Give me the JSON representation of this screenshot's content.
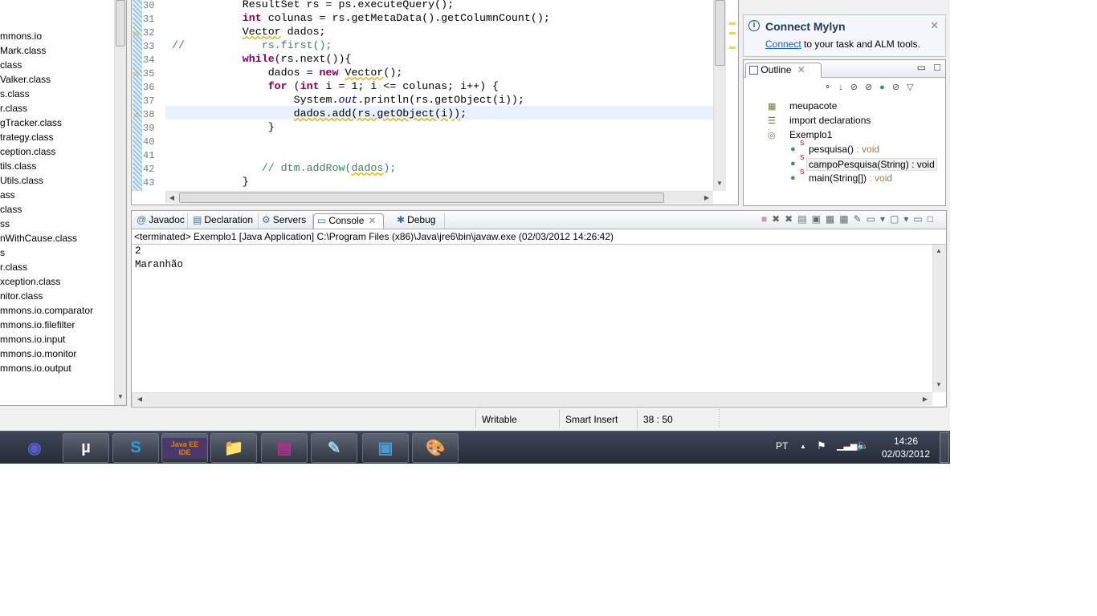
{
  "explorer": {
    "items": [
      "mmons.io",
      "Mark.class",
      "class",
      "Valker.class",
      "s.class",
      "r.class",
      "gTracker.class",
      "trategy.class",
      "ception.class",
      "tils.class",
      "Utils.class",
      "ass",
      "class",
      "ss",
      "nWithCause.class",
      "s",
      "r.class",
      "xception.class",
      "nitor.class",
      "mmons.io.comparator",
      "mmons.io.filefilter",
      "mmons.io.input",
      "mmons.io.monitor",
      "mmons.io.output"
    ]
  },
  "editor": {
    "line_numbers": [
      "30",
      "31",
      "32",
      "33",
      "34",
      "35",
      "36",
      "37",
      "38",
      "39",
      "40",
      "41",
      "42",
      "43"
    ],
    "warning_lines": [
      "32",
      "35",
      "38"
    ],
    "current_line": "38",
    "lines": [
      [
        {
          "t": "           ResultSet rs = ps.executeQuery();",
          "c": ""
        }
      ],
      [
        {
          "t": "           ",
          "c": ""
        },
        {
          "t": "int",
          "c": "kw"
        },
        {
          "t": " colunas = rs.getMetaData().getColumnCount();",
          "c": ""
        }
      ],
      [
        {
          "t": "           ",
          "c": ""
        },
        {
          "t": "Vector",
          "c": "wv"
        },
        {
          "t": " dados;",
          "c": ""
        }
      ],
      [
        {
          "t": "//            rs.first();",
          "c": "cm"
        }
      ],
      [
        {
          "t": "           ",
          "c": ""
        },
        {
          "t": "while",
          "c": "kw"
        },
        {
          "t": "(rs.next()){",
          "c": ""
        }
      ],
      [
        {
          "t": "               dados = ",
          "c": ""
        },
        {
          "t": "new",
          "c": "kw"
        },
        {
          "t": " ",
          "c": ""
        },
        {
          "t": "Vector",
          "c": "wv"
        },
        {
          "t": "();",
          "c": ""
        }
      ],
      [
        {
          "t": "               ",
          "c": ""
        },
        {
          "t": "for",
          "c": "kw"
        },
        {
          "t": " (",
          "c": ""
        },
        {
          "t": "int",
          "c": "kw"
        },
        {
          "t": " i = 1; i <= colunas; i++) {",
          "c": ""
        }
      ],
      [
        {
          "t": "                   System.",
          "c": ""
        },
        {
          "t": "out",
          "c": "fld"
        },
        {
          "t": ".println(rs.getObject(i));",
          "c": ""
        }
      ],
      [
        {
          "t": "                   ",
          "c": ""
        },
        {
          "t": "dados.add(rs.getObject(i))",
          "c": "wv"
        },
        {
          "t": ";",
          "c": ""
        }
      ],
      [
        {
          "t": "               }",
          "c": ""
        }
      ],
      [
        {
          "t": "",
          "c": ""
        }
      ],
      [
        {
          "t": "",
          "c": ""
        }
      ],
      [
        {
          "t": "              // dtm.addRow(",
          "c": "cm"
        },
        {
          "t": "dados",
          "c": "cm wv"
        },
        {
          "t": ");",
          "c": "cm"
        }
      ],
      [
        {
          "t": "           }",
          "c": ""
        }
      ]
    ]
  },
  "mylyn": {
    "title": "Connect Mylyn",
    "link": "Connect",
    "text": " to your task and ALM tools."
  },
  "outline": {
    "tab": "Outline",
    "items": [
      {
        "label": "meupacote",
        "type": ""
      },
      {
        "label": "import declarations",
        "type": ""
      },
      {
        "label": "Exemplo1",
        "type": ""
      },
      {
        "label": "pesquisa()",
        "type": " : void"
      },
      {
        "label": "campoPesquisa(String)",
        "type": " : void"
      },
      {
        "label": "main(String[])",
        "type": " : void"
      }
    ]
  },
  "console": {
    "tabs": [
      "Javadoc",
      "Declaration",
      "Servers",
      "Console",
      "Debug"
    ],
    "active_tab": "Console",
    "header": "<terminated> Exemplo1 [Java Application] C:\\Program Files (x86)\\Java\\jre6\\bin\\javaw.exe (02/03/2012 14:26:42)",
    "output": [
      "2",
      "Maranhão"
    ]
  },
  "status": {
    "writable": "Writable",
    "insert_mode": "Smart Insert",
    "position": "38 : 50"
  },
  "taskbar": {
    "apps": [
      "eclipse-icon",
      "utorrent-icon",
      "skype-icon",
      "java-ee-ide-icon",
      "explorer-folder-icon",
      "winrar-icon",
      "notepad-icon",
      "remote-desktop-icon",
      "paint-icon"
    ],
    "javaee_label": "Java EE IDE",
    "lang": "PT",
    "time": "14:26",
    "date": "02/03/2012"
  }
}
